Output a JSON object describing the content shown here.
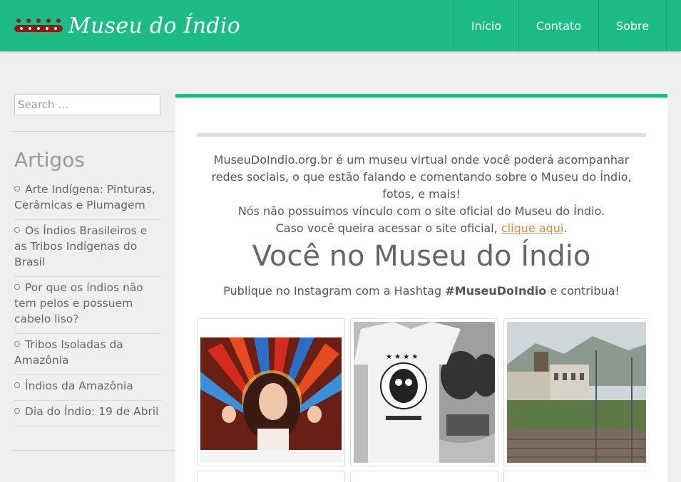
{
  "header": {
    "logo_text": "Museu do Índio",
    "nav": [
      "Início",
      "Contato",
      "Sobre"
    ]
  },
  "sidebar": {
    "search_placeholder": "Search …",
    "widget_title": "Artigos",
    "posts": [
      "Arte Indígena: Pinturas, Cerâmicas e Plumagem",
      "Os Índios Brasileiros e as Tribos Indígenas do Brasil",
      "Por que os índios não tem pelos e possuem cabelo liso?",
      "Tribos Isoladas da Amazônia",
      "Índios da Amazônia",
      "Dia do Índio: 19 de Abril"
    ]
  },
  "main": {
    "intro_line1": "MuseuDoIndio.org.br é um museu virtual onde você poderá acompanhar redes sociais, o que estão falando e comentando sobre o Museu do Índio, fotos, e mais!",
    "intro_line2": "Nós não possuímos vínculo com o site oficial do Museu do Índio.",
    "intro_line3_prefix": "Caso você queira acessar o site oficial,",
    "intro_link": "clique aqui",
    "intro_line3_suffix": ".",
    "title": "Você no Museu do Índio",
    "subtitle_prefix": "Publique no Instagram com a Hashtag",
    "hashtag": "#MuseuDoIndio",
    "subtitle_suffix": "e contribua!"
  },
  "colors": {
    "accent": "#1dbc85",
    "link": "#e6882f",
    "background": "#efefef"
  },
  "icons": [
    "logo-icon",
    "bullet-icon"
  ]
}
